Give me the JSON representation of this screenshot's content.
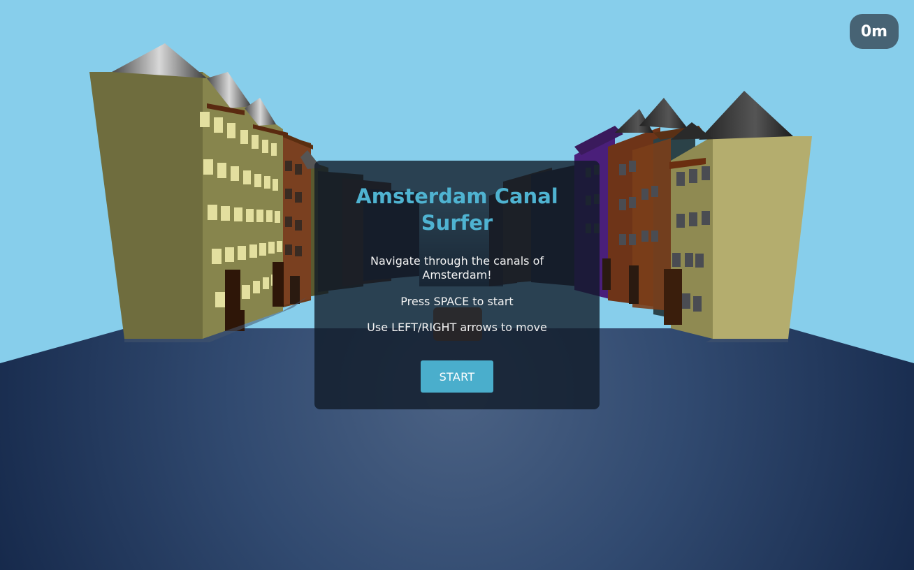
{
  "game": {
    "distance": "0m"
  },
  "start_screen": {
    "title": "Amsterdam Canal Surfer",
    "line_navigate": "Navigate through the canals of Amsterdam!",
    "line_space": "Press SPACE to start",
    "line_arrows": "Use LEFT/RIGHT arrows to move",
    "start_button_label": "START"
  },
  "colors": {
    "sky": "#87ceeb",
    "water_light": "#4a6182",
    "water_dark": "#172a4a",
    "accent": "#4fb3d1",
    "building_olive": "#707040",
    "building_brown": "#7a4020",
    "building_purple": "#4a1f7a",
    "building_teal": "#2e4a52",
    "building_khaki": "#a8a266",
    "window": "#e4e0a2",
    "roof": "#2a2a2a"
  }
}
